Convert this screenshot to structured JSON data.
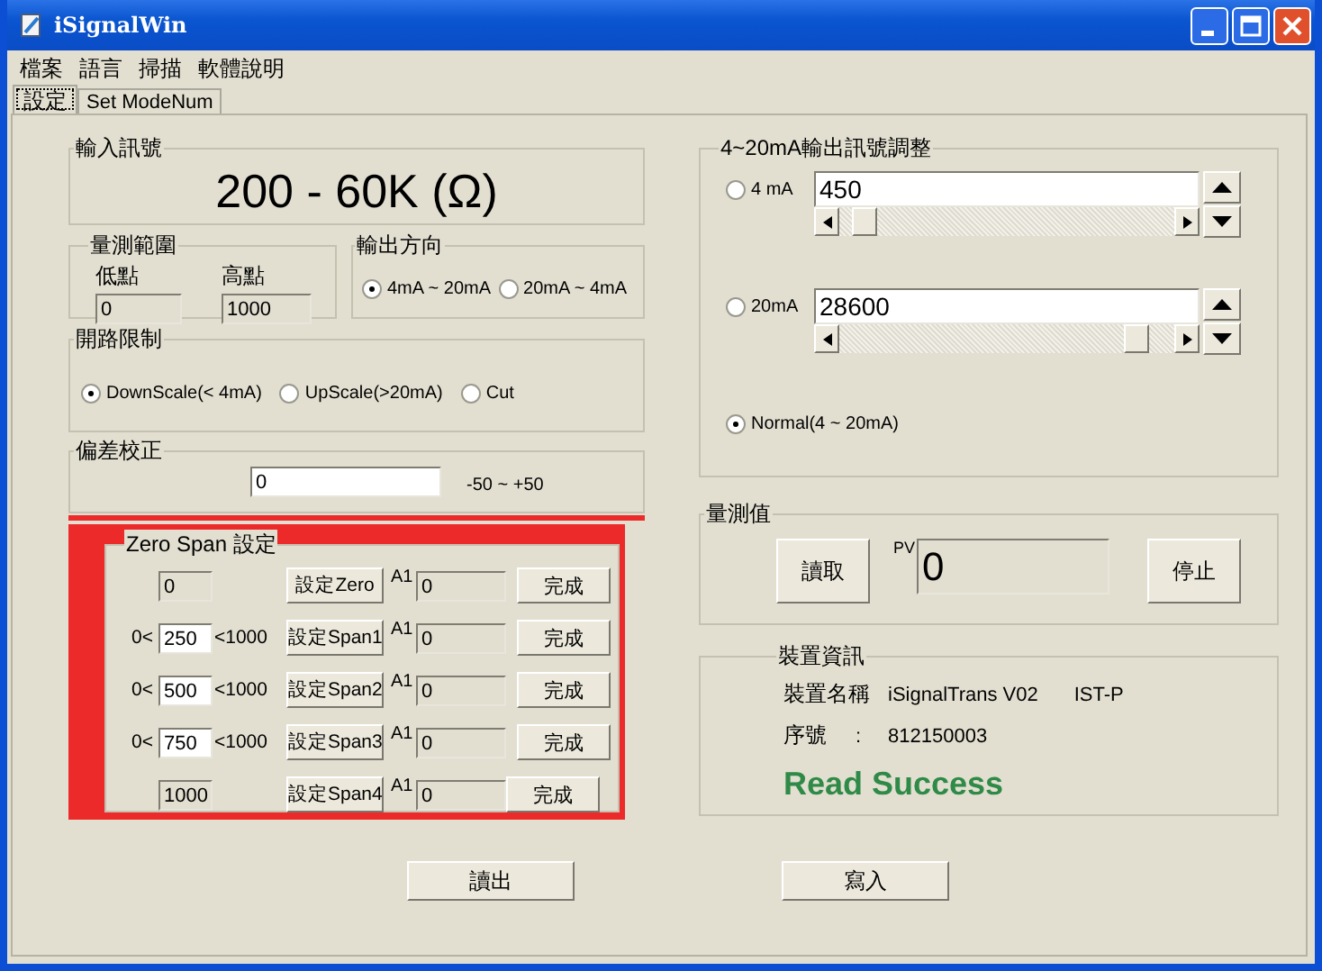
{
  "window": {
    "title": "iSignalWin"
  },
  "menu": [
    "檔案",
    "語言",
    "掃描",
    "軟體說明"
  ],
  "tabs": [
    {
      "label": "設定",
      "selected": true
    },
    {
      "label": "Set ModeNum",
      "selected": false
    }
  ],
  "input_signal": {
    "label": "輸入訊號",
    "value": "200 - 60K (Ω)"
  },
  "measure_range": {
    "label": "量測範圍",
    "low": {
      "label": "低點",
      "value": "0",
      "disabled": true
    },
    "high": {
      "label": "高點",
      "value": "1000",
      "disabled": true
    }
  },
  "output_direction": {
    "label": "輸出方向",
    "options": [
      {
        "label": "4mA ~ 20mA",
        "selected": true
      },
      {
        "label": "20mA ~ 4mA",
        "selected": false
      }
    ]
  },
  "open_circuit": {
    "label": "開路限制",
    "options": [
      {
        "label": "DownScale(< 4mA)",
        "selected": true
      },
      {
        "label": "UpScale(>20mA)",
        "selected": false
      },
      {
        "label": "Cut",
        "selected": false
      }
    ]
  },
  "offset": {
    "label": "偏差校正",
    "value": "0",
    "range": "-50 ~ +50"
  },
  "zero_span": {
    "label": "Zero Span 設定",
    "highlighted": true,
    "rows": [
      {
        "field": {
          "value": "0",
          "disabled": true
        },
        "button": "設定Zero",
        "a1_label": "A1",
        "a1": {
          "value": "0",
          "disabled": true
        },
        "done": "完成"
      },
      {
        "prefix": "0<",
        "field": {
          "value": "250",
          "disabled": false
        },
        "suffix": "<1000",
        "button": "設定Span1",
        "a1_label": "A1",
        "a1": {
          "value": "0",
          "disabled": true
        },
        "done": "完成"
      },
      {
        "prefix": "0<",
        "field": {
          "value": "500",
          "disabled": false
        },
        "suffix": "<1000",
        "button": "設定Span2",
        "a1_label": "A1",
        "a1": {
          "value": "0",
          "disabled": true
        },
        "done": "完成"
      },
      {
        "prefix": "0<",
        "field": {
          "value": "750",
          "disabled": false
        },
        "suffix": "<1000",
        "button": "設定Span3",
        "a1_label": "A1",
        "a1": {
          "value": "0",
          "disabled": true
        },
        "done": "完成"
      },
      {
        "field": {
          "value": "1000",
          "disabled": true
        },
        "button": "設定Span4",
        "a1_label": "A1",
        "a1": {
          "value": "0",
          "disabled": true
        },
        "done": "完成"
      }
    ]
  },
  "output_adjust": {
    "label": "4~20mA輸出訊號調整",
    "options": [
      {
        "kind": "slider",
        "label": "4 mA",
        "selected": false,
        "value": "450"
      },
      {
        "kind": "slider",
        "label": "20mA",
        "selected": false,
        "value": "28600"
      },
      {
        "kind": "plain",
        "label": "Normal(4 ~ 20mA)",
        "selected": true
      }
    ]
  },
  "measurement": {
    "label": "量測值",
    "read_button": "讀取",
    "pv_label": "PV",
    "pv_value": "0",
    "stop_button": "停止"
  },
  "device_info": {
    "label": "裝置資訊",
    "name_label": "裝置名稱",
    "name_value": "iSignalTrans V02",
    "model": "IST-P",
    "serial_label": "序號",
    "serial_separator": ":",
    "serial_value": "812150003",
    "status": "Read Success"
  },
  "buttons": [
    "讀出",
    "寫入"
  ]
}
